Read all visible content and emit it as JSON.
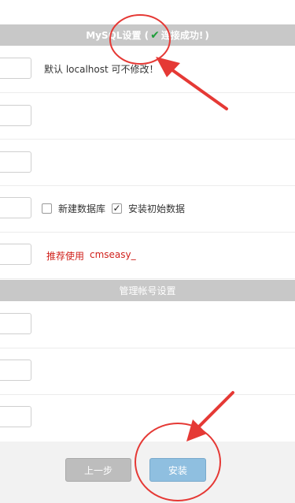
{
  "mysql_section": {
    "title_prefix": "MySQL设置 (",
    "title_status": "连接成功!",
    "title_suffix": ")",
    "check_icon": "check-icon",
    "status_color": "#1f9d3a"
  },
  "db_rows": {
    "host_hint": "默认 localhost 可不修改！",
    "new_db_label": "新建数据库",
    "new_db_checked": false,
    "install_data_label": "安装初始数据",
    "install_data_checked": true,
    "prefix_hint_label": "推荐使用",
    "prefix_hint_value": "cmseasy_"
  },
  "admin_section": {
    "title": "管理帐号设置"
  },
  "footer": {
    "prev_label": "上一步",
    "install_label": "安装"
  },
  "annotations": {
    "color": "#e53935"
  }
}
